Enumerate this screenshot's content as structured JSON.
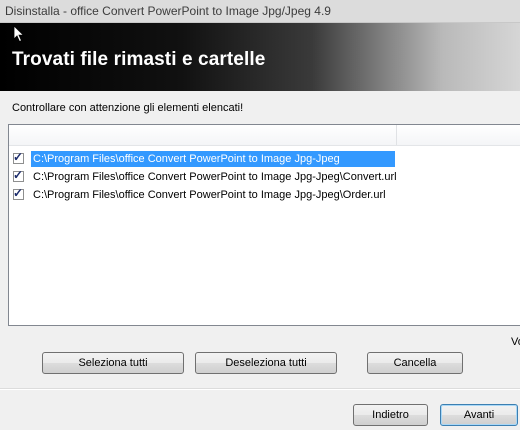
{
  "window": {
    "title": "Disinstalla - office Convert PowerPoint to Image Jpg/Jpeg 4.9"
  },
  "banner": {
    "heading": "Trovati file rimasti e cartelle"
  },
  "main": {
    "instruction": "Controllare con attenzione gli elementi elencati!",
    "items": [
      {
        "path": "C:\\Program Files\\office Convert PowerPoint to Image Jpg-Jpeg",
        "checked": true,
        "selected": true
      },
      {
        "path": "C:\\Program Files\\office Convert PowerPoint to Image Jpg-Jpeg\\Convert.url",
        "checked": true,
        "selected": false
      },
      {
        "path": "C:\\Program Files\\office Convert PowerPoint to Image Jpg-Jpeg\\Order.url",
        "checked": true,
        "selected": false
      }
    ],
    "cut_label": "Vo"
  },
  "buttons": {
    "select_all": "Seleziona tutti",
    "deselect_all": "Deseleziona tutti",
    "cancel": "Cancella",
    "back": "Indietro",
    "next": "Avanti"
  },
  "icons": {
    "cursor": "mouse-pointer-icon",
    "checkbox": "checkbox-checked-icon"
  }
}
